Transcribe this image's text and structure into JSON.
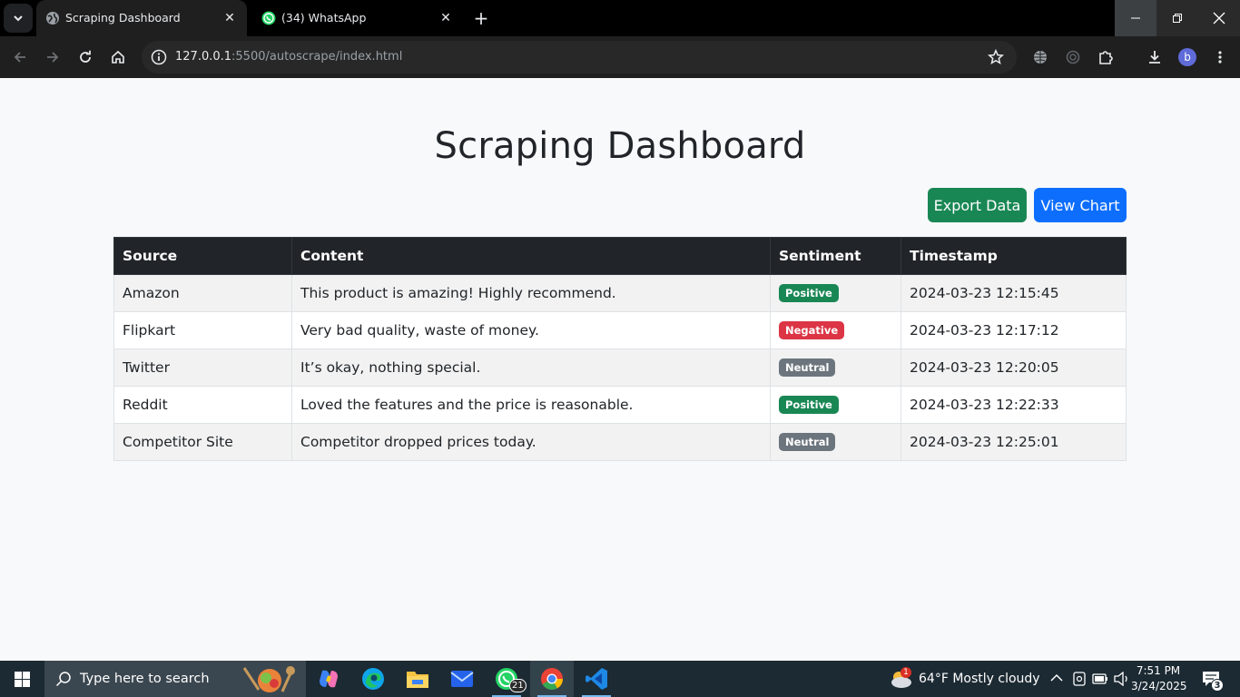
{
  "browser": {
    "tabs": [
      {
        "title": "Scraping Dashboard",
        "active": true
      },
      {
        "title": "(34) WhatsApp",
        "active": false
      }
    ],
    "url_host": "127.0.0.1",
    "url_rest": ":5500/autoscrape/index.html",
    "profile_initial": "b"
  },
  "page": {
    "title": "Scraping Dashboard",
    "buttons": {
      "export": "Export Data",
      "chart": "View Chart"
    },
    "table": {
      "headers": [
        "Source",
        "Content",
        "Sentiment",
        "Timestamp"
      ],
      "rows": [
        {
          "source": "Amazon",
          "content": "This product is amazing! Highly recommend.",
          "sentiment": "Positive",
          "timestamp": "2024-03-23 12:15:45"
        },
        {
          "source": "Flipkart",
          "content": "Very bad quality, waste of money.",
          "sentiment": "Negative",
          "timestamp": "2024-03-23 12:17:12"
        },
        {
          "source": "Twitter",
          "content": "It’s okay, nothing special.",
          "sentiment": "Neutral",
          "timestamp": "2024-03-23 12:20:05"
        },
        {
          "source": "Reddit",
          "content": "Loved the features and the price is reasonable.",
          "sentiment": "Positive",
          "timestamp": "2024-03-23 12:22:33"
        },
        {
          "source": "Competitor Site",
          "content": "Competitor dropped prices today.",
          "sentiment": "Neutral",
          "timestamp": "2024-03-23 12:25:01"
        }
      ]
    },
    "sentiment_colors": {
      "Positive": "#198754",
      "Negative": "#dc3545",
      "Neutral": "#6c757d"
    }
  },
  "taskbar": {
    "search_placeholder": "Type here to search",
    "whatsapp_badge": "21",
    "weather_alert": "1",
    "weather": "64°F  Mostly cloudy",
    "time": "7:51 PM",
    "date": "3/24/2025",
    "notifications": "3"
  }
}
